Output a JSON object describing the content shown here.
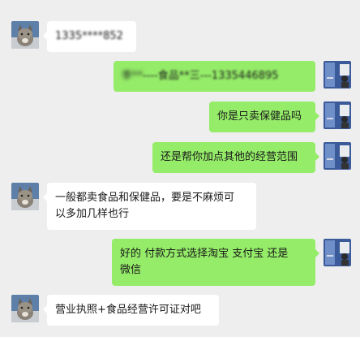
{
  "messages": [
    {
      "side": "in",
      "text": "1335****852"
    },
    {
      "side": "out",
      "text_a": "李**",
      "text_b": "----食品**三---1335446895"
    },
    {
      "side": "out",
      "text": "你是只卖保健品吗"
    },
    {
      "side": "out",
      "text": "还是帮你加点其他的经营范围"
    },
    {
      "side": "in",
      "line1": "一般都卖食品和保健品，要是不麻烦可",
      "line2": "以多加几样也行"
    },
    {
      "side": "out",
      "line1": "好的  付款方式选择淘宝  支付宝 还是",
      "line2": "微信"
    },
    {
      "side": "in",
      "text": "营业执照+食品经营许可证对吧"
    }
  ],
  "avatars": {
    "contact": "cat-avatar-icon",
    "self": "scenery-avatar-icon"
  }
}
